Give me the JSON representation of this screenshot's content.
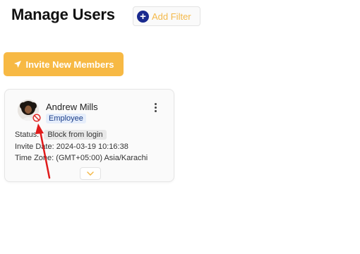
{
  "header": {
    "title": "Manage Users",
    "add_filter_label": "Add Filter"
  },
  "toolbar": {
    "invite_label": "Invite New Members"
  },
  "user_card": {
    "name": "Andrew Mills",
    "role": "Employee",
    "status_label": "Status:",
    "status_value": "Block from login",
    "invite_date_label": "Invite Date:",
    "invite_date_value": "2024-03-19 10:16:38",
    "timezone_label": "Time Zone:",
    "timezone_value": "(GMT+05:00) Asia/Karachi"
  },
  "colors": {
    "accent": "#f7b944",
    "filter_icon": "#1a2a8f",
    "badge_bg": "#e6eefb",
    "block_icon": "#e0312d",
    "annotation_arrow": "#e01b1b"
  },
  "icons": {
    "add_filter": "plus-circle-icon",
    "invite": "paper-plane-icon",
    "blocked": "block-icon",
    "more": "vertical-dots-icon",
    "expand": "chevron-down-icon"
  }
}
